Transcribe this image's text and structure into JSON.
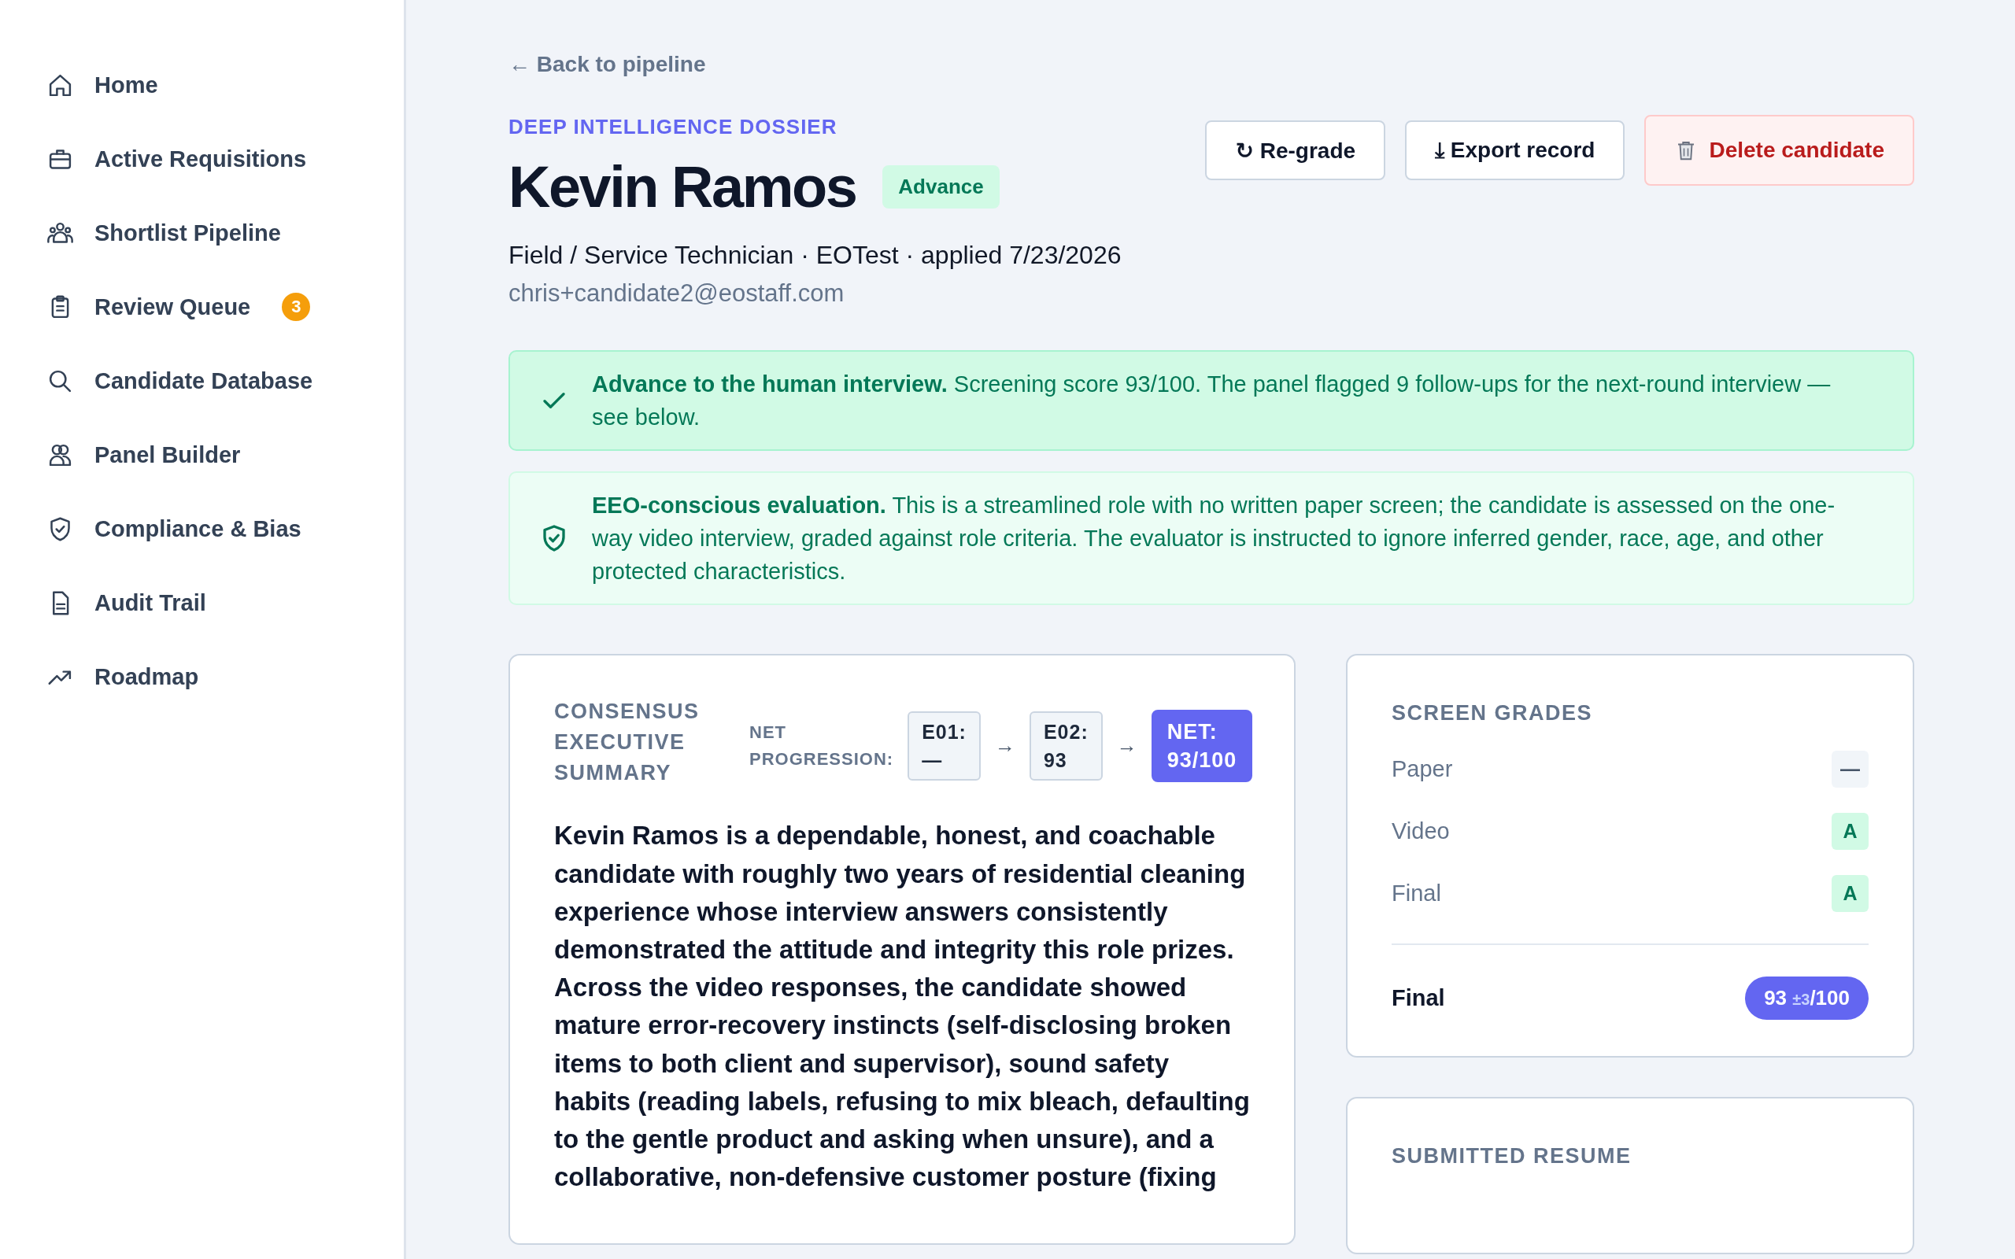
{
  "sidebar": {
    "items": [
      {
        "label": "Home",
        "selected": false
      },
      {
        "label": "Active Requisitions",
        "selected": false
      },
      {
        "label": "Shortlist Pipeline",
        "selected": false
      },
      {
        "label": "Review Queue",
        "selected": false,
        "badge": "3"
      },
      {
        "label": "Candidate Database",
        "selected": false
      },
      {
        "label": "Panel Builder",
        "selected": false
      },
      {
        "label": "Compliance & Bias",
        "selected": false
      },
      {
        "label": "Audit Trail",
        "selected": false
      },
      {
        "label": "Roadmap",
        "selected": false
      }
    ]
  },
  "back_link": "← Back to pipeline",
  "header": {
    "eyebrow": "DEEP INTELLIGENCE DOSSIER",
    "name": "Kevin Ramos",
    "status": "Advance",
    "meta": "Field / Service Technician · EOTest · applied 7/23/2026",
    "email": "chris+candidate2@eostaff.com"
  },
  "actions": [
    {
      "label": "↻ Re-grade",
      "kind": "default"
    },
    {
      "label": "⤓ Export record",
      "kind": "default"
    },
    {
      "label": "Delete candidate",
      "kind": "danger"
    }
  ],
  "banners": [
    {
      "kind": "success",
      "text": "**Advance to the human interview.** Screening score 93/100. The panel flagged 9 follow-ups for the next-round interview — see below."
    },
    {
      "kind": "info",
      "text": "**EEO-conscious evaluation.** This is a streamlined role with no written paper screen; the candidate is assessed on the one-way video interview, graded against role criteria. The evaluator is instructed to ignore inferred gender, race, age, and other protected characteristics."
    }
  ],
  "summary": {
    "title": "CONSENSUS EXECUTIVE SUMMARY",
    "progression_label": "NET PROGRESSION:",
    "steps": [
      {
        "kind": "step",
        "label": "E01:",
        "value": "—"
      },
      {
        "kind": "step",
        "label": "E02:",
        "value": "93"
      },
      {
        "kind": "net",
        "label": "NET:",
        "value": "93/100"
      }
    ],
    "arrow": "→",
    "text": "Kevin Ramos is a dependable, honest, and coachable candidate with roughly two years of residential cleaning experience whose interview answers consistently demonstrated the attitude and integrity this role prizes. Across the video responses, the candidate showed mature error-recovery instincts (self-disclosing broken items to both client and supervisor), sound safety habits (reading labels, refusing to mix bleach, defaulting to the gentle product and asking when unsure), and a collaborative, non-defensive customer posture (fixing"
  },
  "screen_grades": {
    "title": "SCREEN GRADES",
    "rows": [
      {
        "label": "Paper",
        "grade": "—",
        "kind": "empty"
      },
      {
        "label": "Video",
        "grade": "A",
        "kind": "grade"
      },
      {
        "label": "Final",
        "grade": "A",
        "kind": "grade"
      }
    ],
    "final": {
      "label": "Final",
      "score": "93",
      "margin": "±3",
      "total": "/100"
    }
  },
  "resume": {
    "title": "SUBMITTED RESUME"
  }
}
